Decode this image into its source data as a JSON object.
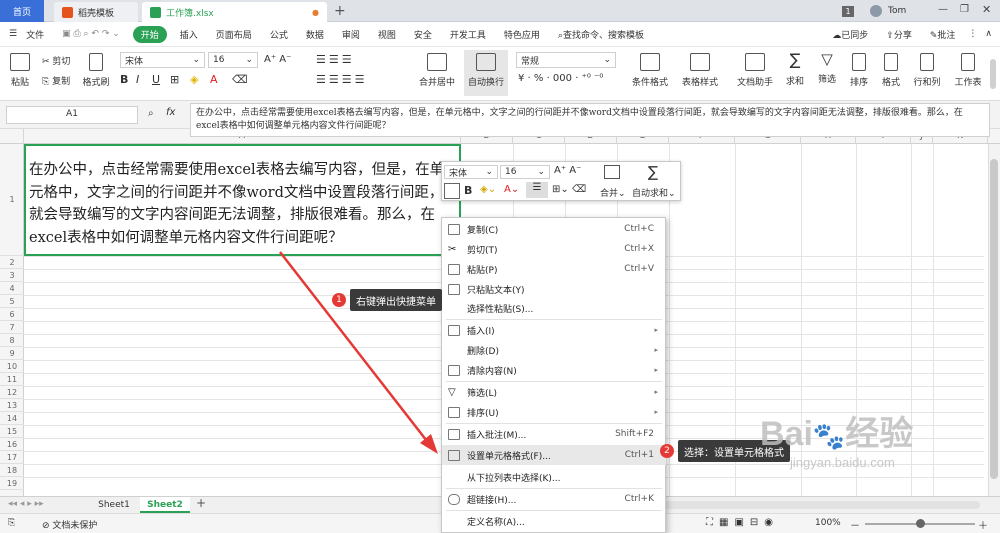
{
  "tabs": {
    "home": "首页",
    "template": "稻壳模板",
    "book": "工作簿.xlsx",
    "add": "+",
    "page_num": "1",
    "user": "Tom"
  },
  "menu": {
    "file": "文件",
    "items": [
      "开始",
      "插入",
      "页面布局",
      "公式",
      "数据",
      "审阅",
      "视图",
      "安全",
      "开发工具",
      "特色应用"
    ],
    "search": "查找命令、搜索模板",
    "sync": "已同步",
    "share": "分享",
    "comment": "批注"
  },
  "ribbon": {
    "paste": "粘贴",
    "cut": "剪切",
    "copy": "复制",
    "format_painter": "格式刷",
    "font": "宋体",
    "size": "16",
    "merge": "合并居中",
    "wrap": "自动换行",
    "numfmt": "常规",
    "cond": "条件格式",
    "table_style": "表格样式",
    "doc_helper": "文档助手",
    "sum": "求和",
    "filter": "筛选",
    "sort": "排序",
    "format": "格式",
    "rowcol": "行和列",
    "sheet": "工作表",
    "bold": "B",
    "italic": "I",
    "underline": "U",
    "fontcolor": "A"
  },
  "formula_bar": {
    "cell_ref": "A1",
    "fx": "fx",
    "content": "在办公中，点击经常需要使用excel表格去编写内容，但是，在单元格中，文字之间的行间距并不像word文档中设置段落行间距，就会导致编写的文字内容间距无法调整，排版很难看。那么，在excel表格中如何调整单元格内容文件行间距呢？"
  },
  "columns": [
    "A",
    "B",
    "C",
    "D",
    "E",
    "F",
    "G",
    "H",
    "I",
    "J",
    "K"
  ],
  "rows": [
    "1",
    "2",
    "3",
    "4",
    "5",
    "6",
    "7",
    "8",
    "9",
    "10",
    "11",
    "12",
    "13",
    "14",
    "15",
    "16",
    "17",
    "18",
    "19"
  ],
  "cell_a1": "在办公中，点击经常需要使用excel表格去编写内容，但是，在单元格中，文字之间的行间距并不像word文档中设置段落行间距，就会导致编写的文字内容间距无法调整，排版很难看。那么，在excel表格中如何调整单元格内容文件行间距呢？",
  "minibar": {
    "font": "宋体",
    "size": "16",
    "merge": "合并",
    "autosum": "自动求和",
    "bold": "B"
  },
  "context_menu": [
    {
      "label": "复制(C)",
      "shortcut": "Ctrl+C",
      "sub": false
    },
    {
      "label": "剪切(T)",
      "shortcut": "Ctrl+X",
      "sub": false
    },
    {
      "label": "粘贴(P)",
      "shortcut": "Ctrl+V",
      "sub": false
    },
    {
      "label": "只粘贴文本(Y)",
      "shortcut": "",
      "sub": false
    },
    {
      "label": "选择性粘贴(S)...",
      "shortcut": "",
      "sub": false
    },
    {
      "label": "插入(I)",
      "shortcut": "",
      "sub": true
    },
    {
      "label": "删除(D)",
      "shortcut": "",
      "sub": true
    },
    {
      "label": "清除内容(N)",
      "shortcut": "",
      "sub": true
    },
    {
      "label": "筛选(L)",
      "shortcut": "",
      "sub": true
    },
    {
      "label": "排序(U)",
      "shortcut": "",
      "sub": true
    },
    {
      "label": "插入批注(M)...",
      "shortcut": "Shift+F2",
      "sub": false
    },
    {
      "label": "设置单元格格式(F)...",
      "shortcut": "Ctrl+1",
      "sub": false
    },
    {
      "label": "从下拉列表中选择(K)...",
      "shortcut": "",
      "sub": false
    },
    {
      "label": "超链接(H)...",
      "shortcut": "Ctrl+K",
      "sub": false
    },
    {
      "label": "定义名称(A)...",
      "shortcut": "",
      "sub": false
    }
  ],
  "callouts": {
    "one_num": "1",
    "one": "右键弹出快捷菜单",
    "two_num": "2",
    "two": "选择：设置单元格格式"
  },
  "sheets": {
    "s1": "Sheet1",
    "s2": "Sheet2",
    "add": "+"
  },
  "status": {
    "protect": "文档未保护",
    "zoom": "100%",
    "minus": "－",
    "plus": "＋"
  },
  "watermark": {
    "text": "Bai",
    "paw": "du",
    "jingyan": "经验",
    "url": "jingyan.baidu.com"
  },
  "colors": {
    "accent": "#2aa155",
    "callout_badge": "#e53935",
    "arrow": "#e53935",
    "tab_home": "#3a6fd8",
    "menu_hover": "#e8e8e8"
  }
}
